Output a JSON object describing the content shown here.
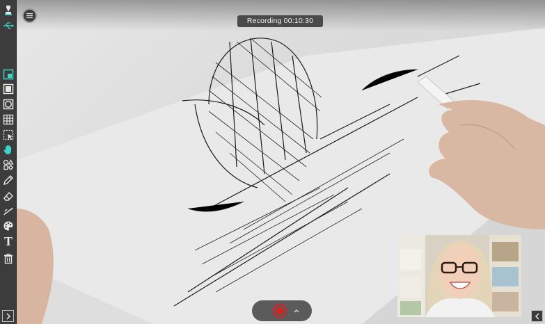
{
  "recording": {
    "status_text": "Recording 00:10:30"
  },
  "toolbar": {
    "tools": [
      {
        "name": "brand-logo",
        "icon": "brand-logo-icon"
      },
      {
        "name": "usb",
        "icon": "usb-icon"
      },
      {
        "name": "screen-region",
        "icon": "screen-region-icon"
      },
      {
        "name": "square",
        "icon": "square-icon"
      },
      {
        "name": "rounded-frame",
        "icon": "rounded-frame-icon"
      },
      {
        "name": "grid",
        "icon": "grid-icon"
      },
      {
        "name": "selection",
        "icon": "selection-icon"
      },
      {
        "name": "hand",
        "icon": "hand-icon"
      },
      {
        "name": "shapes",
        "icon": "shapes-icon"
      },
      {
        "name": "pencil",
        "icon": "pencil-icon"
      },
      {
        "name": "eraser",
        "icon": "eraser-icon"
      },
      {
        "name": "marker",
        "icon": "marker-icon"
      },
      {
        "name": "palette",
        "icon": "palette-icon"
      },
      {
        "name": "text",
        "icon": "text-icon",
        "label": "T"
      },
      {
        "name": "trash",
        "icon": "trash-icon"
      }
    ]
  },
  "colors": {
    "toolbar_bg": "#3c3c3c",
    "accent": "#3fd3c8",
    "record_red": "#e21b1b",
    "pill_bg": "#4a4a4a"
  }
}
